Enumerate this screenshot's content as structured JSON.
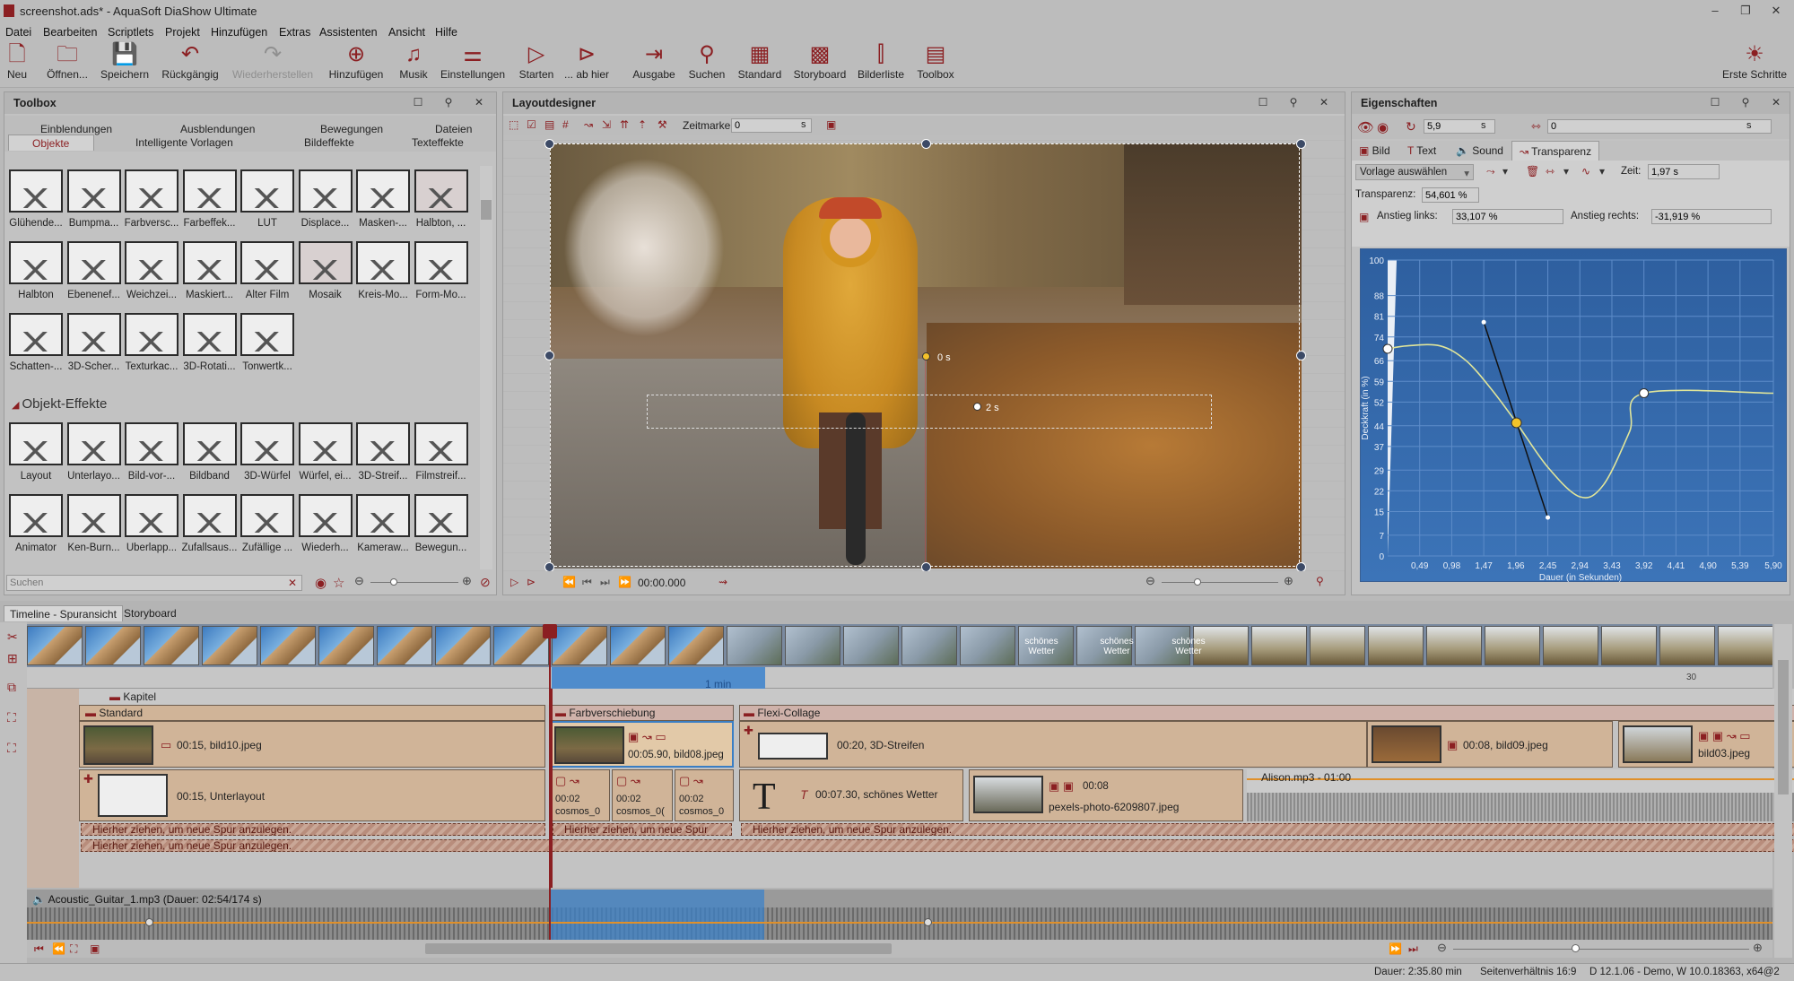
{
  "title_bar": {
    "title": "screenshot.ads* - AquaSoft DiaShow Ultimate",
    "minimize": "–",
    "restore": "❐",
    "close": "✕"
  },
  "menu": [
    "Datei",
    "Bearbeiten",
    "Scriptlets",
    "Projekt",
    "Hinzufügen",
    "Extras",
    "Assistenten",
    "Ansicht",
    "Hilfe"
  ],
  "toolbar": {
    "neu": "Neu",
    "oeffnen": "Öffnen...",
    "speichern": "Speichern",
    "rueckgaengig": "Rückgängig",
    "wiederherstellen": "Wiederherstellen",
    "hinzufuegen": "Hinzufügen",
    "musik": "Musik",
    "einstellungen": "Einstellungen",
    "starten": "Starten",
    "ab_hier": "... ab hier",
    "ausgabe": "Ausgabe",
    "suchen": "Suchen",
    "standard": "Standard",
    "storyboard": "Storyboard",
    "bilderliste": "Bilderliste",
    "toolbox": "Toolbox",
    "erste_schritte": "Erste Schritte"
  },
  "toolbox": {
    "title": "Toolbox",
    "tabs_row1": [
      "Einblendungen",
      "Ausblendungen",
      "Bewegungen",
      "Dateien"
    ],
    "tabs_row2": [
      "Objekte",
      "Intelligente Vorlagen",
      "Bildeffekte",
      "Texteffekte"
    ],
    "effects": [
      "Glühende...",
      "Bumpma...",
      "Farbversc...",
      "Farbeffek...",
      "LUT",
      "Displace...",
      "Masken-...",
      "Halbton, ...",
      "Halbton",
      "Ebenenef...",
      "Weichzei...",
      "Maskiert...",
      "Alter Film",
      "Mosaik",
      "Kreis-Mo...",
      "Form-Mo...",
      "Schatten-...",
      "3D-Scher...",
      "Texturkac...",
      "3D-Rotati...",
      "Tonwertk..."
    ],
    "section": "Objekt-Effekte",
    "objects": [
      "Layout",
      "Unterlayo...",
      "Bild-vor-...",
      "Bildband",
      "3D-Würfel",
      "Würfel, ei...",
      "3D-Streif...",
      "Filmstreif...",
      "Animator",
      "Ken-Burn...",
      "Überlapp...",
      "Zufallsaus...",
      "Zufällige ...",
      "Wiederh...",
      "Kameraw...",
      "Bewegun..."
    ],
    "search_placeholder": "Suchen"
  },
  "layout": {
    "title": "Layoutdesigner",
    "zeitmarke_label": "Zeitmarke:",
    "zeitmarke_value": "0",
    "unit": "s",
    "time": "00:00.000",
    "marker1": "0 s",
    "marker2": "2 s"
  },
  "properties": {
    "title": "Eigenschaften",
    "rotation": "5,9",
    "offset": "0",
    "unit": "s",
    "tabs": [
      "Bild",
      "Text",
      "Sound",
      "Transparenz"
    ],
    "vorlage": "Vorlage auswählen",
    "zeit_label": "Zeit:",
    "zeit_value": "1,97 s",
    "transparenz_label": "Transparenz:",
    "transparenz_value": "54,601 %",
    "anstieg_links_label": "Anstieg links:",
    "anstieg_links_value": "33,107 %",
    "anstieg_rechts_label": "Anstieg rechts:",
    "anstieg_rechts_value": "-31,919 %"
  },
  "chart_data": {
    "type": "line",
    "ylabel": "Deckkraft (in %)",
    "xlabel": "Dauer (in Sekunden)",
    "yticks": [
      "100",
      "88",
      "81",
      "74",
      "66",
      "59",
      "52",
      "44",
      "37",
      "29",
      "22",
      "15",
      "7",
      "0"
    ],
    "xticks": [
      "0,49",
      "0,98",
      "1,47",
      "1,96",
      "2,45",
      "2,94",
      "3,43",
      "3,92",
      "4,41",
      "4,90",
      "5,39",
      "5,90"
    ],
    "ylim": [
      0,
      100
    ],
    "xlim": [
      0,
      5.9
    ],
    "series": [
      {
        "x": [
          0,
          0.3,
          0.8,
          1.2,
          1.6,
          1.97,
          2.45,
          2.94,
          3.3,
          3.7,
          3.92,
          5.9
        ],
        "y": [
          70,
          71,
          71,
          66,
          56,
          45,
          30,
          20,
          24,
          42,
          55,
          55
        ]
      }
    ],
    "keypoints": [
      {
        "x": 0,
        "y": 70
      },
      {
        "x": 1.97,
        "y": 45
      },
      {
        "x": 3.92,
        "y": 55
      }
    ],
    "tangent": {
      "x": [
        1.47,
        2.45
      ],
      "y": [
        79,
        13
      ]
    }
  },
  "timeline": {
    "tab1": "Timeline - Spuransicht",
    "tab2": "Storyboard",
    "ruler": [
      "1 min"
    ],
    "time_marker": "30",
    "kapitel": "Kapitel",
    "standard": "Standard",
    "farbverschiebung": "Farbverschiebung",
    "flexi": "Flexi-Collage",
    "bild10": "00:15, bild10.jpeg",
    "bild08": "00:05.90, bild08.jpeg",
    "streifen": "00:20, 3D-Streifen",
    "bild09": "00:08, bild09.jpeg",
    "bild03": "bild03.jpeg",
    "unterlayout": "00:15, Unterlayout",
    "cosmos1": "00:02",
    "cosmos1b": "cosmos_0",
    "cosmos2": "00:02",
    "cosmos2b": "cosmos_0(",
    "cosmos3": "00:02",
    "cosmos3b": "cosmos_0",
    "wetter": "00:07.30, schönes Wetter",
    "pexels_time": "00:08",
    "pexels": "pexels-photo-6209807.jpeg",
    "alison": "Alison.mp3 - 01:00",
    "hint": "Hierher ziehen, um neue Spur anzulegen.",
    "hint_short": "Hierher ziehen, um neue Spur",
    "guitar": "Acoustic_Guitar_1.mp3 (Dauer: 02:54/174 s)",
    "wetter_thumb": "schönes Wetter"
  },
  "status": {
    "dauer": "Dauer: 2:35.80 min",
    "seiten": "Seitenverhältnis 16:9",
    "version": "D 12.1.06 - Demo, W 10.0.18363, x64@2"
  },
  "colors": {
    "accent": "#8b1f22",
    "track": "#d0b498",
    "selection": "#3a7ec4",
    "curve_bg": "#3468aa"
  }
}
